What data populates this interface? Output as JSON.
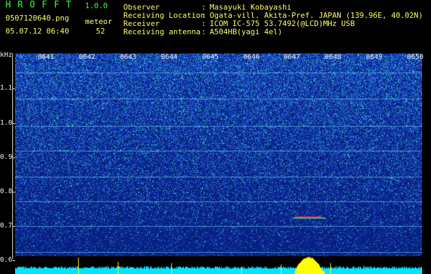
{
  "app": {
    "title_letters": "H R O F F T",
    "version": "1.0.0"
  },
  "file": {
    "name": "0507120640.png",
    "datetime": "05.07.12 06:40"
  },
  "meteor": {
    "label": "meteor",
    "count": "52"
  },
  "info": [
    {
      "key": "Observer",
      "sep": ":",
      "value": "Masayuki Kobayashi"
    },
    {
      "key": "Receiving Location",
      "sep": ":",
      "value": "Ogata-vill. Akita-Pref. JAPAN (139.96E, 40.02N)"
    },
    {
      "key": "Receiver",
      "sep": ":",
      "value": "ICOM IC-575 53.7492(@LCD)MHz USB"
    },
    {
      "key": "Receiving antenna",
      "sep": ":",
      "value": "A504HB(yagi 4el)"
    }
  ],
  "yaxis": {
    "unit": "kHz",
    "ticks": [
      "1.1",
      "1.0",
      "0.9",
      "0.8",
      "0.7",
      "0.6"
    ]
  },
  "xaxis": {
    "ticks": [
      "0641",
      "0642",
      "0643",
      "0644",
      "0645",
      "0646",
      "0647",
      "0648",
      "0649",
      "0650"
    ]
  },
  "colors": {
    "background": "#000000",
    "spectrogram_base": "#06167a",
    "header_green": "#3cff3c",
    "header_yellow": "#ffff66",
    "meter_cyan": "#00e5ff",
    "meter_yellow": "#ffff00",
    "echo_red": "#ff3030"
  }
}
